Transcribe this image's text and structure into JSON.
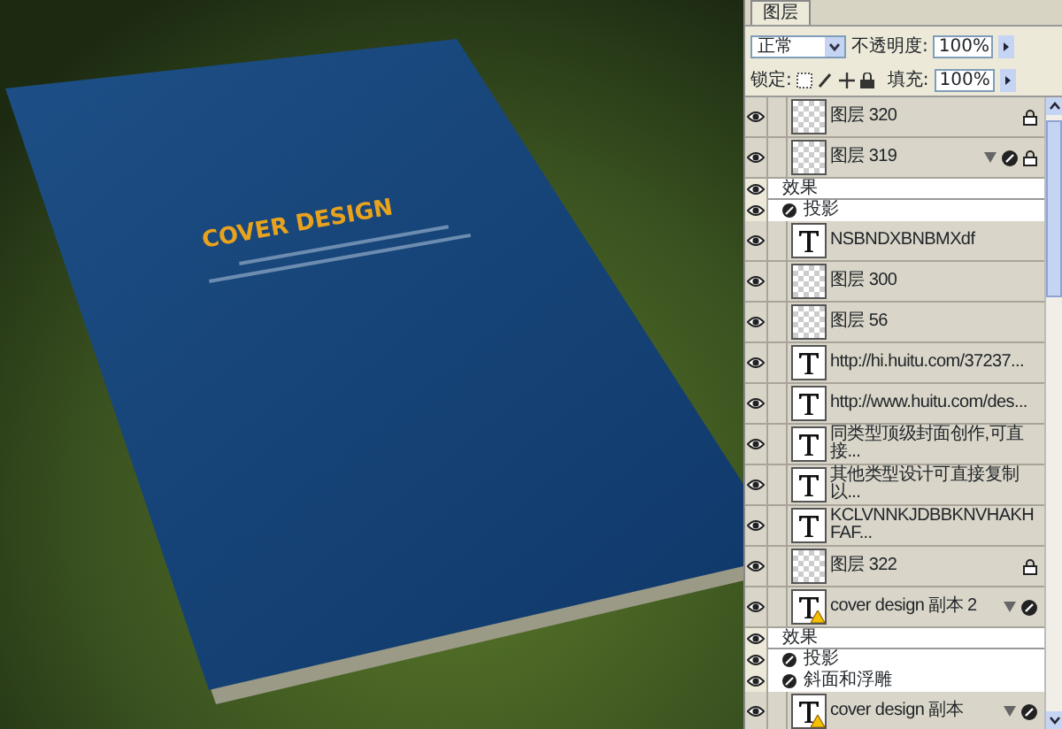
{
  "canvas": {
    "cover_title": "COVER DESIGN"
  },
  "panel": {
    "tab": {
      "label": "图层",
      "selected": true
    },
    "blend_mode": "正常",
    "opacity_label": "不透明度:",
    "opacity": "100%",
    "lock_label": "锁定:",
    "fill_label": "填充:",
    "fill": "100%"
  },
  "layers": [
    {
      "kind": "pixel",
      "name": "图层 320",
      "visible": true,
      "locked": true
    },
    {
      "kind": "pixel",
      "name": "图层 319",
      "visible": true,
      "locked": true,
      "effects": {
        "label": "效果",
        "items": [
          "投影"
        ]
      }
    },
    {
      "kind": "text",
      "name": "NSBNDXBNBMXdf",
      "visible": true
    },
    {
      "kind": "pixel",
      "name": "图层 300",
      "visible": true
    },
    {
      "kind": "pixel",
      "name": "图层 56",
      "visible": true
    },
    {
      "kind": "text",
      "name": "http://hi.huitu.com/37237...",
      "visible": true
    },
    {
      "kind": "text",
      "name": "http://www.huitu.com/des...",
      "visible": true
    },
    {
      "kind": "text",
      "name": "同类型顶级封面创作,可直接...",
      "visible": true
    },
    {
      "kind": "text",
      "name": "其他类型设计可直接复制以...",
      "visible": true
    },
    {
      "kind": "text",
      "name": "KCLVNNKJDBBKNVHAKHFAF...",
      "visible": true
    },
    {
      "kind": "pixel",
      "name": "图层 322",
      "visible": true,
      "locked": true
    },
    {
      "kind": "text",
      "name": "cover design 副本 2",
      "visible": true,
      "warning": true,
      "effects": {
        "label": "效果",
        "items": [
          "投影",
          "斜面和浮雕"
        ]
      }
    },
    {
      "kind": "text",
      "name": "cover design 副本",
      "visible": true,
      "warning": true,
      "fx": true
    }
  ]
}
